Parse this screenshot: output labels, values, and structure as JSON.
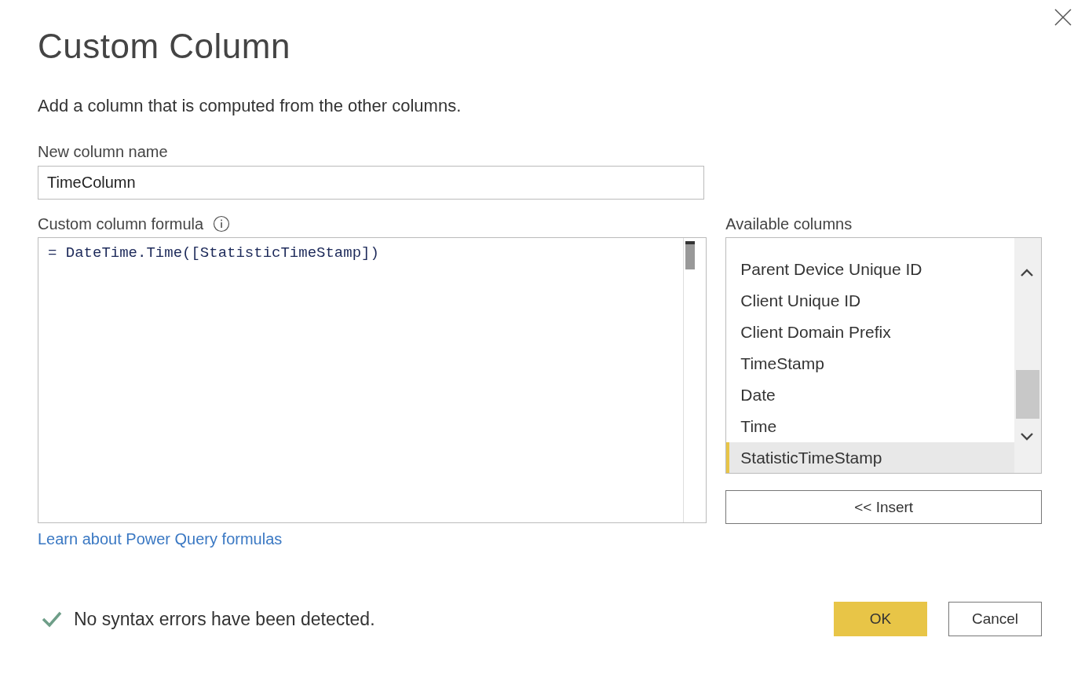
{
  "dialog": {
    "title": "Custom Column",
    "description": "Add a column that is computed from the other columns."
  },
  "name_field": {
    "label": "New column name",
    "value": "TimeColumn"
  },
  "formula": {
    "label": "Custom column formula",
    "value": "= DateTime.Time([StatisticTimeStamp])"
  },
  "available_columns": {
    "label": "Available columns",
    "items": [
      {
        "label": "Parent Device Unique ID",
        "selected": false
      },
      {
        "label": "Client Unique ID",
        "selected": false
      },
      {
        "label": "Client Domain Prefix",
        "selected": false
      },
      {
        "label": "TimeStamp",
        "selected": false
      },
      {
        "label": "Date",
        "selected": false
      },
      {
        "label": "Time",
        "selected": false
      },
      {
        "label": "StatisticTimeStamp",
        "selected": true
      }
    ]
  },
  "insert_button": "<< Insert",
  "link": "Learn about Power Query formulas",
  "status": "No syntax errors have been detected.",
  "buttons": [
    {
      "label": "OK",
      "kind": "primary"
    },
    {
      "label": "Cancel",
      "kind": "secondary"
    }
  ]
}
